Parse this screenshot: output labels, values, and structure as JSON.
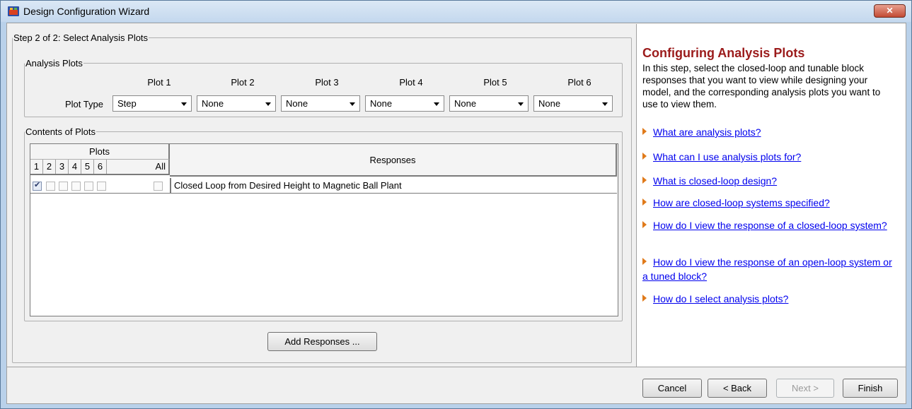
{
  "window": {
    "title": "Design Configuration Wizard",
    "close_label": "✕"
  },
  "step": {
    "legend": "Step 2 of 2: Select Analysis Plots"
  },
  "analysis_plots": {
    "legend": "Analysis Plots",
    "plot_type_label": "Plot Type",
    "plots": [
      {
        "header": "Plot 1",
        "value": "Step"
      },
      {
        "header": "Plot 2",
        "value": "None"
      },
      {
        "header": "Plot 3",
        "value": "None"
      },
      {
        "header": "Plot 4",
        "value": "None"
      },
      {
        "header": "Plot 5",
        "value": "None"
      },
      {
        "header": "Plot 6",
        "value": "None"
      }
    ]
  },
  "contents": {
    "legend": "Contents of Plots",
    "plots_header": "Plots",
    "plot_numbers": [
      "1",
      "2",
      "3",
      "4",
      "5",
      "6",
      "All"
    ],
    "responses_header": "Responses",
    "rows": [
      {
        "checked": [
          true,
          false,
          false,
          false,
          false,
          false,
          false
        ],
        "response": "Closed Loop from Desired Height to Magnetic Ball Plant"
      }
    ]
  },
  "add_responses_label": "Add Responses ...",
  "help": {
    "title": "Configuring Analysis Plots",
    "description": "In this step, select the closed-loop and tunable block responses that you want to view while designing your model, and the corresponding analysis plots you want to use to view them.",
    "links": [
      "What are analysis plots?",
      "What can I use analysis plots for?",
      "What is closed-loop design?",
      "How are closed-loop systems specified?",
      "How do I view the response of a closed-loop system?",
      "How do I view the response of an open-loop system or a tuned block?",
      "How do I select analysis plots?"
    ]
  },
  "footer": {
    "cancel": "Cancel",
    "back": "< Back",
    "next": "Next >",
    "finish": "Finish"
  },
  "icons": {
    "app": "simulink-wizard-icon",
    "dropdown": "chevron-down-icon",
    "bullet": "triangle-bullet-icon"
  },
  "colors": {
    "help_title": "#9b1b1b",
    "link": "#0000ee",
    "bullet": "#e07a1a"
  }
}
